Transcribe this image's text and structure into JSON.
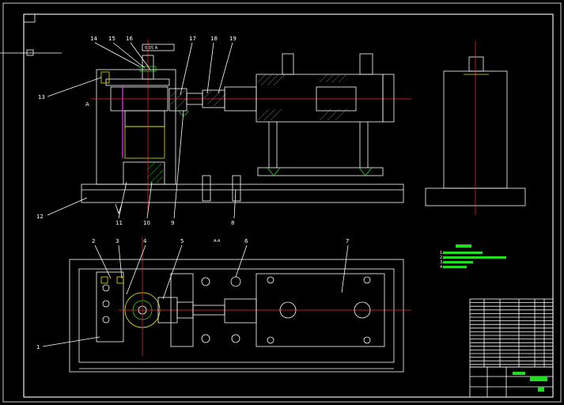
{
  "sheet": {
    "background": "#000000",
    "line_color": "#ffffff",
    "center_color": "#ff2a2a",
    "hatch_color": "#22dd22"
  },
  "callouts": {
    "top": [
      {
        "n": "14"
      },
      {
        "n": "15"
      },
      {
        "n": "16"
      },
      {
        "n": "17"
      },
      {
        "n": "18"
      },
      {
        "n": "19"
      }
    ],
    "left": [
      {
        "n": "13"
      },
      {
        "n": "12"
      }
    ],
    "bottom_front": [
      {
        "n": "11"
      },
      {
        "n": "10"
      },
      {
        "n": "9"
      },
      {
        "n": "8"
      }
    ],
    "plan_top": [
      {
        "n": "2"
      },
      {
        "n": "3"
      },
      {
        "n": "4"
      },
      {
        "n": "5"
      },
      {
        "n": "6"
      },
      {
        "n": "7"
      }
    ],
    "plan_left": [
      {
        "n": "1"
      }
    ]
  },
  "section_mark": "A",
  "view_label": "A-A",
  "tolerance_frame": "0.05 A",
  "notes": {
    "line1": "1.",
    "line2": "2.",
    "line3": "3.",
    "line4": "4."
  }
}
